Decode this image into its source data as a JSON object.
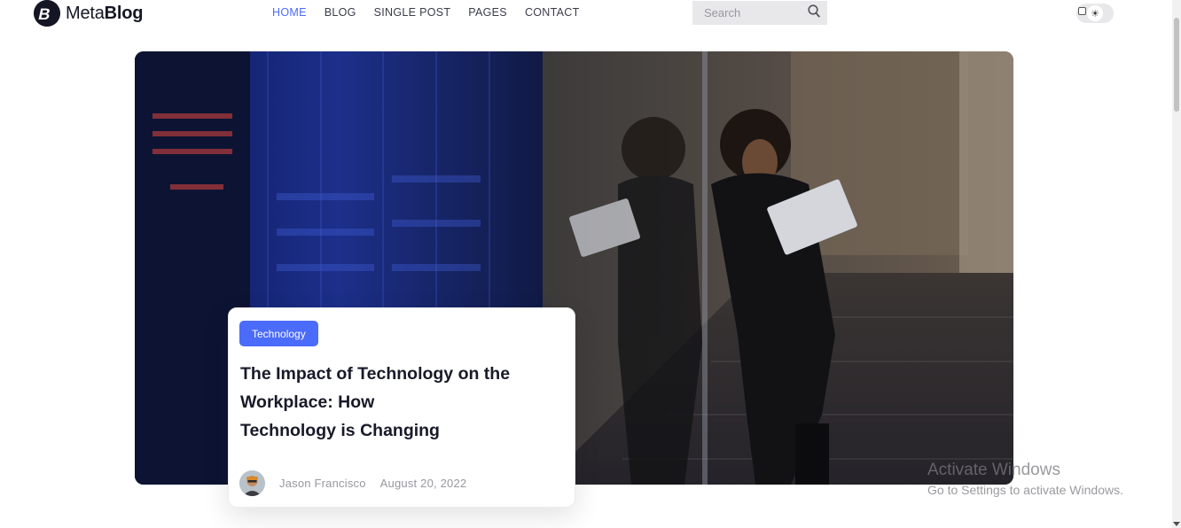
{
  "header": {
    "logo_regular": "Meta",
    "logo_bold": "Blog",
    "nav": [
      {
        "label": "HOME",
        "active": true
      },
      {
        "label": "BLOG",
        "active": false
      },
      {
        "label": "SINGLE POST",
        "active": false
      },
      {
        "label": "PAGES",
        "active": false
      },
      {
        "label": "CONTACT",
        "active": false
      }
    ],
    "search": {
      "placeholder": "Search",
      "value": ""
    },
    "theme_toggle": {
      "icon": "sun-icon",
      "state": "light"
    }
  },
  "hero": {
    "image_icon": "server-room-photo",
    "card": {
      "category": "Technology",
      "title_lines": [
        "The Impact of Technology on the",
        "Workplace: How",
        "Technology is Changing"
      ],
      "author": "Jason Francisco",
      "date": "August 20, 2022"
    }
  },
  "os_watermark": {
    "title": "Activate Windows",
    "subtitle": "Go to Settings to activate Windows."
  },
  "colors": {
    "accent": "#4b6bfb",
    "heading": "#181a2a",
    "muted": "#97989f"
  }
}
